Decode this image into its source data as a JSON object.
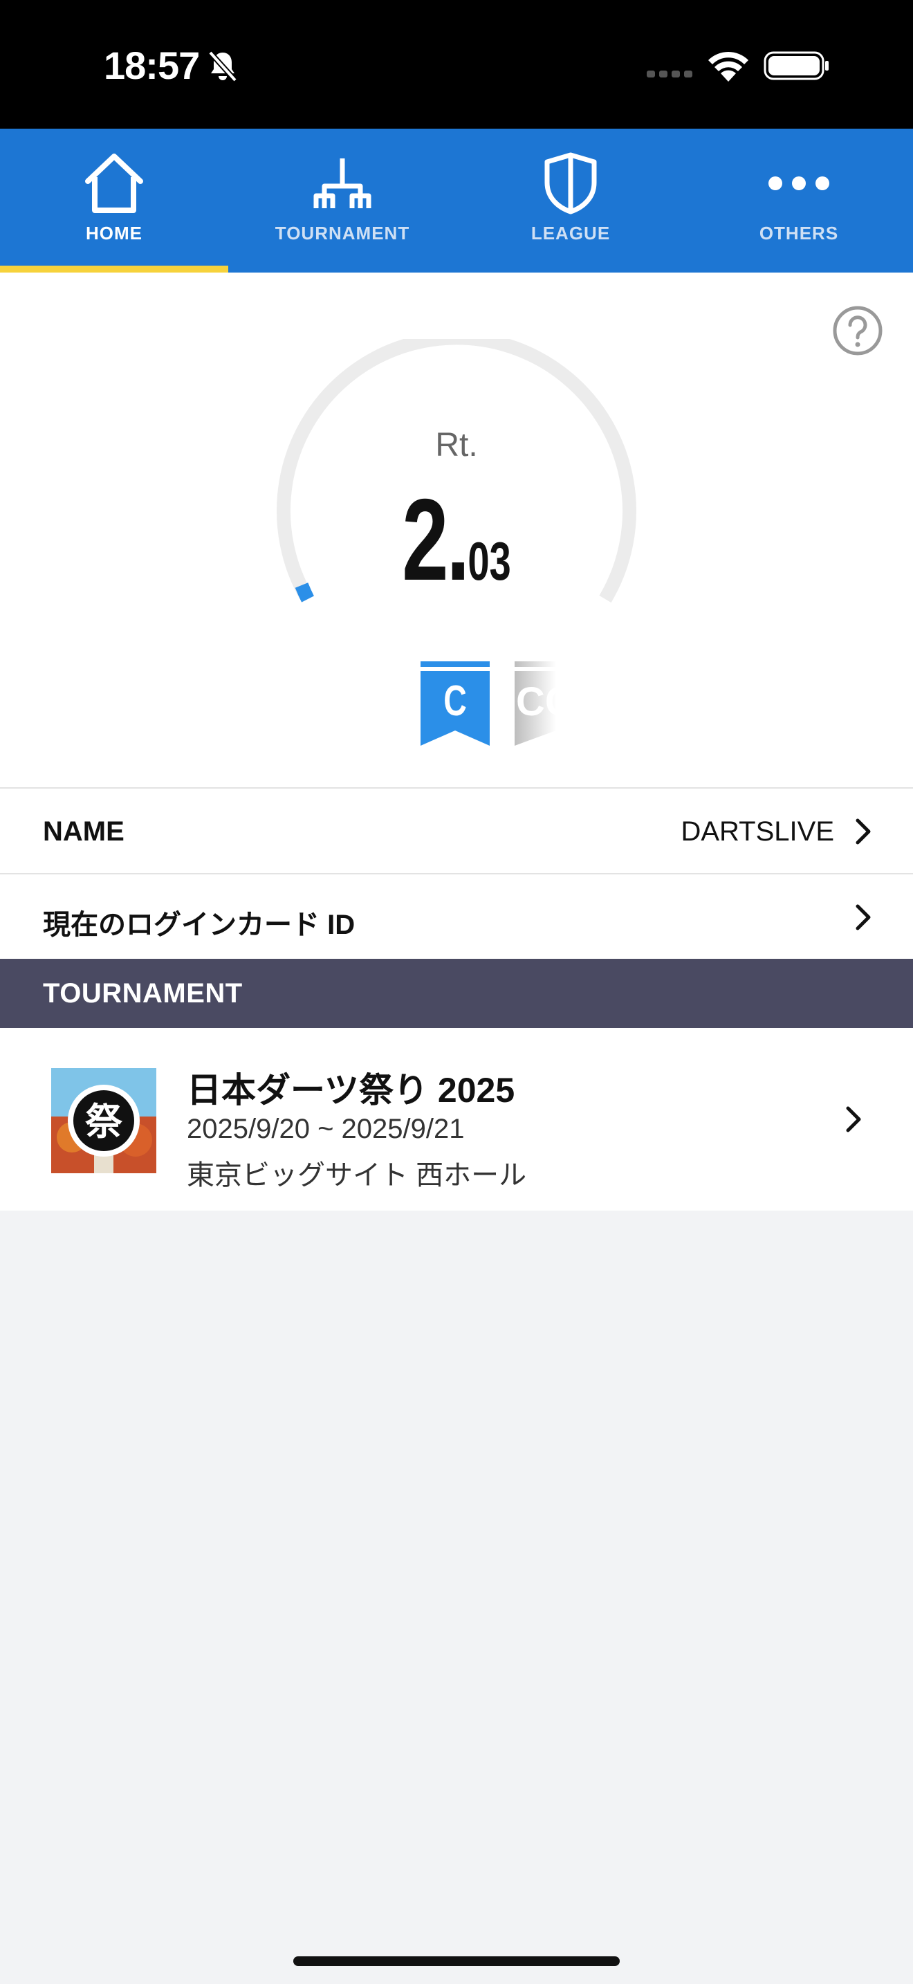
{
  "status_bar": {
    "time": "18:57",
    "icons": [
      "bell-slash-icon",
      "signal-icon",
      "wifi-icon",
      "battery-icon"
    ]
  },
  "tabs": [
    {
      "label": "HOME",
      "icon": "home-icon",
      "active": true
    },
    {
      "label": "TOURNAMENT",
      "icon": "bracket-icon",
      "active": false
    },
    {
      "label": "LEAGUE",
      "icon": "shield-icon",
      "active": false
    },
    {
      "label": "OTHERS",
      "icon": "more-icon",
      "active": false
    }
  ],
  "rating": {
    "label": "Rt.",
    "integer": "2.",
    "decimal": "03",
    "class_flags": [
      "C",
      "CC"
    ]
  },
  "profile": {
    "name_label": "NAME",
    "name_value": "DARTSLIVE",
    "card_label": "現在のログインカード ID"
  },
  "tournament_section": {
    "header": "TOURNAMENT",
    "items": [
      {
        "title": "日本ダーツ祭り 2025",
        "dates": "2025/9/20 ~ 2025/9/21",
        "venue": "東京ビッグサイト 西ホール",
        "thumb_glyph": "祭"
      }
    ]
  },
  "colors": {
    "tab_bar": "#1d76d3",
    "tab_indicator": "#f6d23c",
    "section_header": "#4a4a62",
    "gauge_track": "#ececec",
    "gauge_fill": "#2b8fe8",
    "flag_c": "#2b8fe8"
  }
}
